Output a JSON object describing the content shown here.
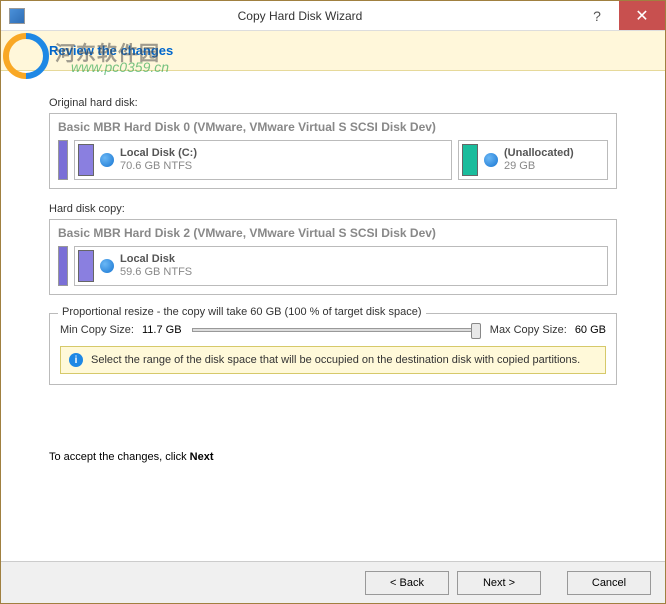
{
  "titlebar": {
    "title": "Copy Hard Disk Wizard"
  },
  "header": {
    "title": "Review the changes"
  },
  "watermark": {
    "text": "河东软件园",
    "url": "www.pc0359.cn"
  },
  "original": {
    "label": "Original hard disk:",
    "disk_title": "Basic MBR Hard Disk 0 (VMware, VMware Virtual S SCSI Disk Dev)",
    "part1_name": "Local Disk (C:)",
    "part1_sub": "70.6 GB NTFS",
    "part2_name": "(Unallocated)",
    "part2_sub": "29 GB"
  },
  "copy": {
    "label": "Hard disk copy:",
    "disk_title": "Basic MBR Hard Disk 2 (VMware, VMware Virtual S SCSI Disk Dev)",
    "part1_name": "Local Disk",
    "part1_sub": "59.6 GB NTFS"
  },
  "resize": {
    "legend": "Proportional resize - the copy will take 60 GB (100 % of target disk space)",
    "min_label": "Min Copy Size:",
    "min_value": "11.7 GB",
    "max_label": "Max Copy Size:",
    "max_value": "60 GB",
    "info": "Select the range of the disk space that will be occupied on the destination disk with copied partitions."
  },
  "accept": {
    "text_pre": "To accept the changes, click ",
    "text_bold": "Next"
  },
  "buttons": {
    "back": "< Back",
    "next": "Next >",
    "cancel": "Cancel"
  }
}
